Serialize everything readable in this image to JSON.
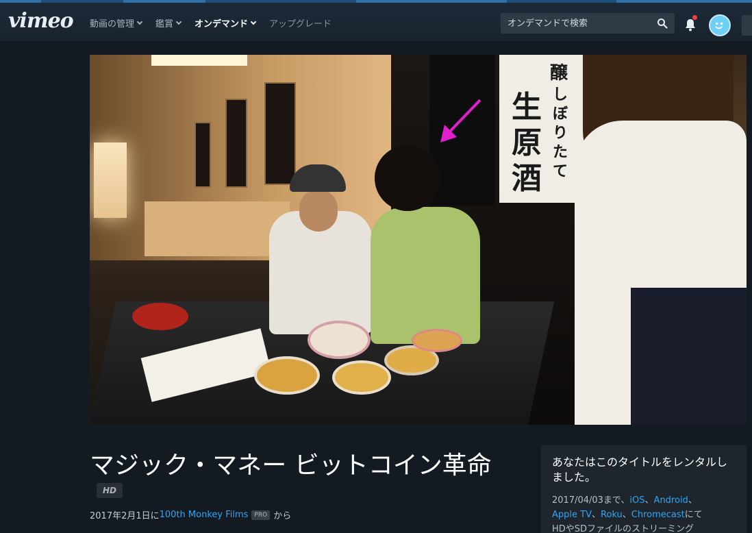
{
  "header": {
    "logo": "vimeo",
    "nav": [
      {
        "label": "動画の管理",
        "has_dropdown": true
      },
      {
        "label": "鑑賞",
        "has_dropdown": true
      },
      {
        "label": "オンデマンド",
        "has_dropdown": true
      },
      {
        "label": "アップグレード",
        "has_dropdown": false
      }
    ],
    "search_placeholder": "オンデマンドで検索",
    "notification_dot_color": "#ff3d3d",
    "avatar_color": "#6fd0f6"
  },
  "video": {
    "banner_chars": [
      "醸",
      "し",
      "ぼ",
      "り",
      "た",
      "て",
      "生",
      "原",
      "酒"
    ],
    "arrow_color": "#e01fcf"
  },
  "title": {
    "text": "マジック・マネー ビットコイン革命",
    "hd_badge": "HD"
  },
  "meta": {
    "date_prefix": "2017年2月1日に",
    "author": "100th Monkey Films",
    "pro_badge": "PRO",
    "suffix": "から"
  },
  "rental": {
    "title": "あなたはこのタイトルをレンタルしました。",
    "until_text": "2017/04/03まで、",
    "platforms": [
      "iOS",
      "Android",
      "Apple TV",
      "Roku",
      "Chromecast"
    ],
    "separator": "、",
    "after_platforms": "にて",
    "line_tail": "HDやSDファイルのストリーミング"
  },
  "colors": {
    "background": "#141a21",
    "header": "#1c2a38",
    "link": "#2fa6f1",
    "panel": "#1e252d"
  }
}
